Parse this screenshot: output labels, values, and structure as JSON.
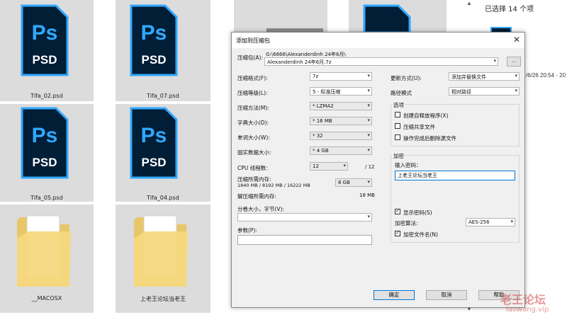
{
  "files": [
    {
      "name": "Tifa_02.psd"
    },
    {
      "name": "Tifa_07.psd"
    },
    {
      "name": "Tifa_05.psd"
    },
    {
      "name": "Tifa_04.psd"
    },
    {
      "name": "__MACOSX"
    },
    {
      "name": "上老王论坛当老王"
    }
  ],
  "icon_text": {
    "ps": "Ps",
    "psd": "PSD"
  },
  "status": {
    "selected": "已选择 14 个项",
    "date_fragment": "/6/26 20:54 - 20"
  },
  "dialog": {
    "title": "添加到压缩包",
    "archive_label": "压缩包(A):",
    "archive_path": "G:\\6666\\Alexanderdinh 24年6月\\",
    "archive_name": "Alexanderdinh 24年6月.7z",
    "browse_label": "...",
    "format_label": "压缩格式(F):",
    "format_value": "7z",
    "level_label": "压缩等级(L):",
    "level_value": "5 - 标准压缩",
    "method_label": "压缩方法(M):",
    "method_value": "* LZMA2",
    "dict_label": "字典大小(D):",
    "dict_value": "* 16 MB",
    "word_label": "单词大小(W):",
    "word_value": "* 32",
    "solid_label": "固实数据大小:",
    "solid_value": "* 4 GB",
    "cpu_label": "CPU 线程数:",
    "cpu_value": "12",
    "cpu_total": "/ 12",
    "mem_label": "压缩所需内存:",
    "mem_detail": "1840 MB / 8192 MB / 16222 MB",
    "mem_value": "8 GB",
    "decomp_label": "解压缩所需内存:",
    "decomp_value": "18 MB",
    "split_label": "分卷大小，字节(V):",
    "params_label": "参数(P):",
    "update_label": "更新方式(U):",
    "update_value": "添加并替换文件",
    "path_label": "路径模式",
    "path_value": "相对路径",
    "options_title": "选项",
    "opt_sfx": "创建自释放程序(X)",
    "opt_shared": "压缩共享文件",
    "opt_delete": "操作完成后删除源文件",
    "enc_title": "加密",
    "enc_pw_label": "输入密码：",
    "enc_pw_value": "上老王论坛当老王",
    "enc_show": "显示密码(S)",
    "enc_method_label": "加密算法:",
    "enc_method_value": "AES-256",
    "enc_names": "加密文件名(N)",
    "ok": "确定",
    "cancel": "取消",
    "help": "帮助"
  },
  "watermark": {
    "cn": "老王论坛",
    "url": "laowang.vip"
  },
  "colors": {
    "ps_blue": "#31a8ff",
    "ps_dark": "#001e36",
    "accent": "#0078d7"
  }
}
